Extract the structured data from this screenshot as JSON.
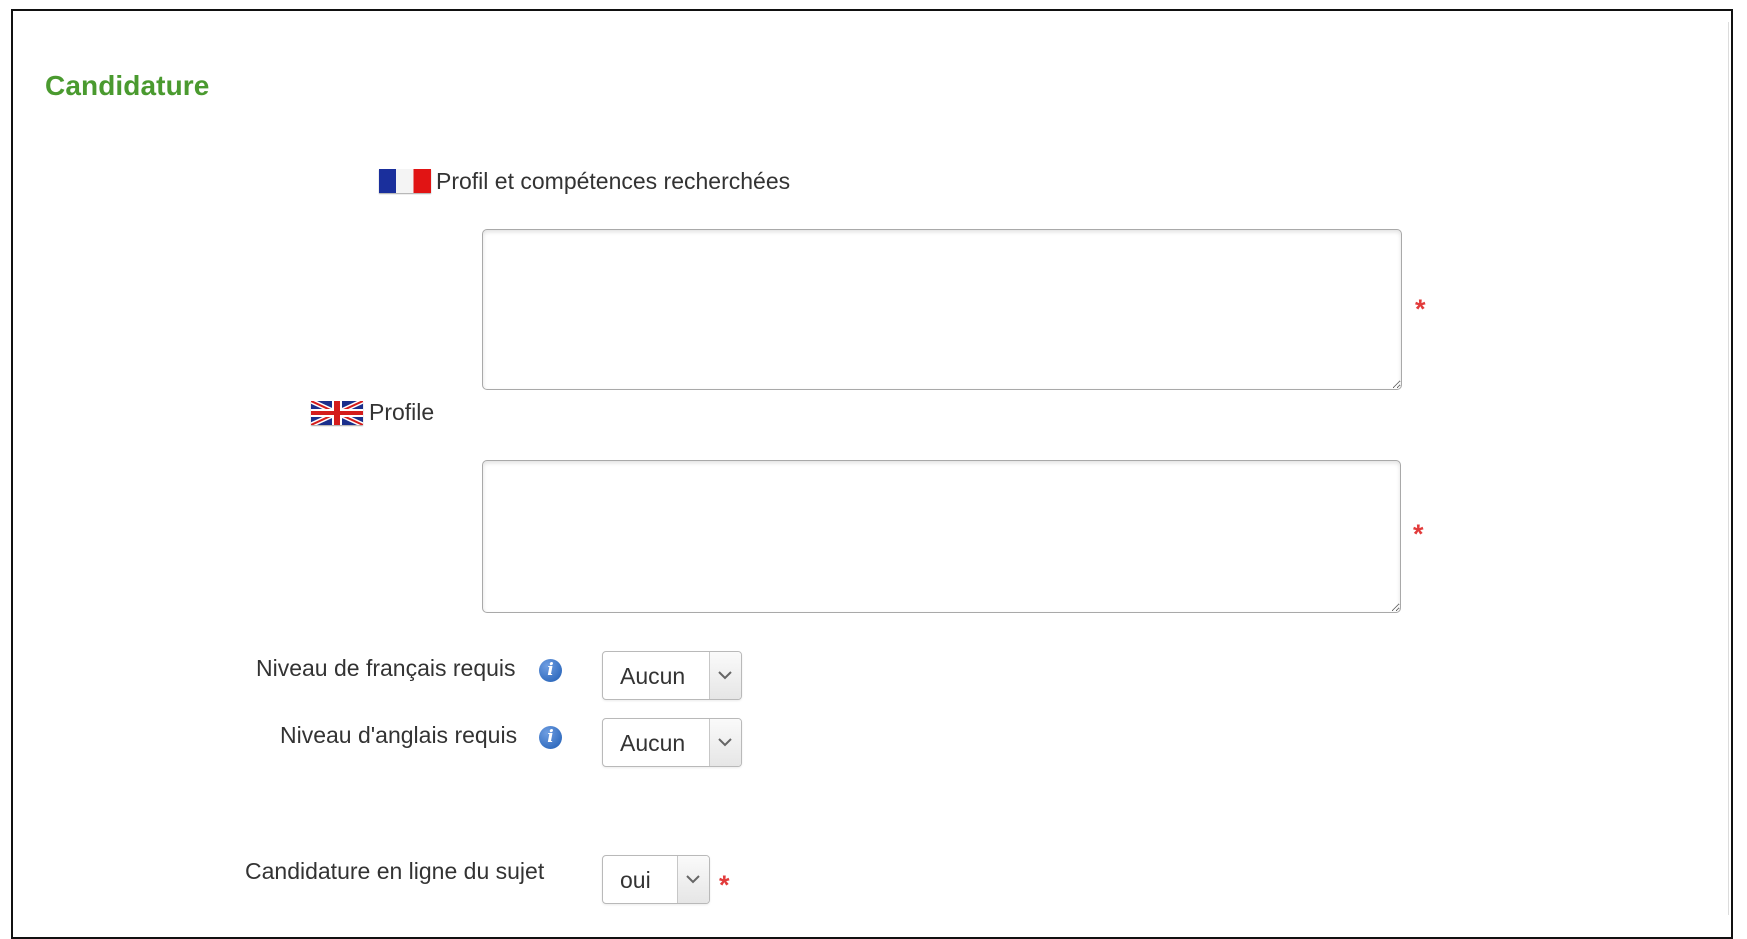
{
  "section": {
    "title": "Candidature"
  },
  "profile_fr": {
    "label": "Profil et compétences recherchées",
    "value": ""
  },
  "profile_en": {
    "label": "Profile",
    "value": ""
  },
  "french_level": {
    "label": "Niveau de français requis",
    "selected": "Aucun"
  },
  "english_level": {
    "label": "Niveau d'anglais requis",
    "selected": "Aucun"
  },
  "online_application": {
    "label": "Candidature en ligne du sujet",
    "selected": "oui"
  },
  "required_marker": "*",
  "info_icon_glyph": "i",
  "icons": {
    "fr_flag": "french-flag-icon",
    "uk_flag": "uk-flag-icon",
    "info": "info-icon",
    "chevron": "chevron-down-icon"
  },
  "colors": {
    "title": "#4a9a2f",
    "required": "#e23b3b",
    "info": "#1e5cb3"
  }
}
